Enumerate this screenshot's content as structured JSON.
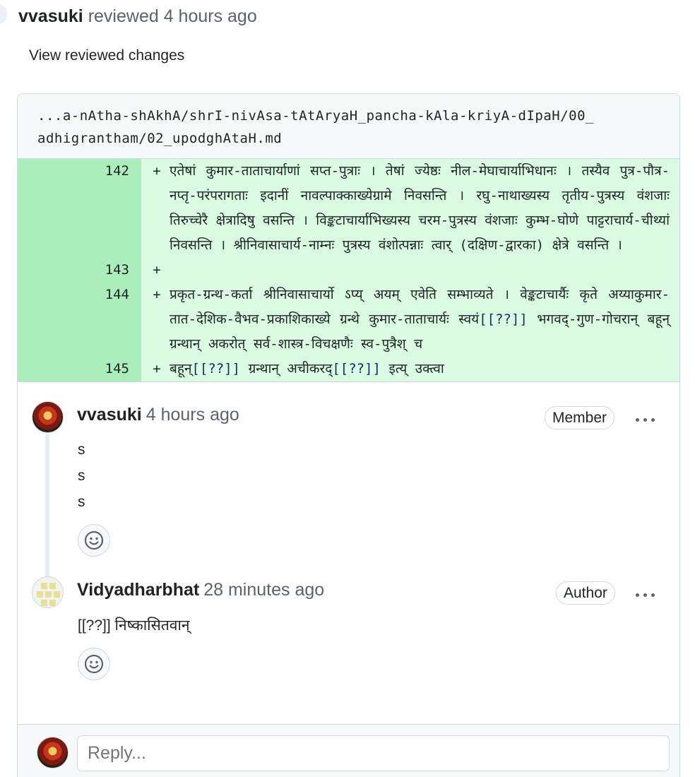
{
  "review": {
    "author": "vvasuki",
    "action": "reviewed 4 hours ago",
    "view_changes_label": "View reviewed changes"
  },
  "file": {
    "path_line1": "...a-nAtha-shAkhA/shrI-nivAsa-tAtAryaH_pancha-kAla-kriyA-dIpaH/00_",
    "path_line2": "adhigrantham/02_upodghAtaH.md"
  },
  "diff": [
    {
      "number": "142",
      "sign": "+",
      "segments": [
        {
          "text": "एतेषां कुमार-ताताचार्याणां सप्त-पुत्राः । तेषां ज्येष्ठः नील-मेघाचार्याभिधानः । तस्यैव पुत्र-पौत्र-नप्तृ-परंपरागताः इदानीं नावल्पाक्काख्येग्रामे निवसन्ति । रघु-नाथाख्यस्य तृतीय-पुत्रस्य वंशजाः तिरुच्चेरै क्षेत्रादिषु वसन्ति । विङ्कटाचार्याभिख्यस्य चरम-पुत्रस्य वंशजाः कुम्भ-घोणे पाट्टराचार्य-चीथ्यां निवसन्ति । श्रीनिवासाचार्य-नाम्नः पुत्रस्य वंशोत्पन्नाः त्वार् (दक्षिण-द्वारका) क्षेत्रे वसन्ति ।",
          "token": false
        }
      ]
    },
    {
      "number": "143",
      "sign": "+",
      "segments": []
    },
    {
      "number": "144",
      "sign": "+",
      "segments": [
        {
          "text": "प्रकृत-ग्रन्थ-कर्ता श्रीनिवासाचार्यो ऽप्य् अयम् एवेति सम्भाव्यते । वेङ्कटाचार्यैः कृते अय्याकुमार-तात-देशिक-वैभव-प्रकाशिकाख्ये ग्रन्थे कुमार-ताताचार्यः स्वयं",
          "token": false
        },
        {
          "text": "[[??]]",
          "token": true
        },
        {
          "text": " भगवद्-गुण-गोचरान् बहून् ग्रन्थान् अकरोत् सर्व-शास्त्र-विचक्षणैः स्व-पुत्रैश् च",
          "token": false
        }
      ]
    },
    {
      "number": "145",
      "sign": "+",
      "segments": [
        {
          "text": "बहून्",
          "token": false
        },
        {
          "text": "[[??]]",
          "token": true
        },
        {
          "text": " ग्रन्थान् अचीकरद्",
          "token": false
        },
        {
          "text": "[[??]]",
          "token": true
        },
        {
          "text": " इत्य् उक्त्वा",
          "token": false
        }
      ]
    }
  ],
  "comments": [
    {
      "author": "vvasuki",
      "time": "4 hours ago",
      "role": "Member",
      "body": [
        "s",
        "s",
        "s"
      ],
      "avatar": "deity-avatar",
      "reaction_icon": "smiley-icon"
    },
    {
      "author": "Vidyadharbhat",
      "time": "28 minutes ago",
      "role": "Author",
      "body": [
        "[[??]] निष्कासितवान्"
      ],
      "avatar": "identicon-avatar",
      "reaction_icon": "smiley-icon"
    }
  ],
  "reply": {
    "placeholder": "Reply..."
  },
  "colors": {
    "added_line_bg": "#dafbe1",
    "added_num_bg": "#aceebb",
    "token_color": "#0a3069",
    "border": "#d1d9e0",
    "muted_text": "#59636e"
  }
}
